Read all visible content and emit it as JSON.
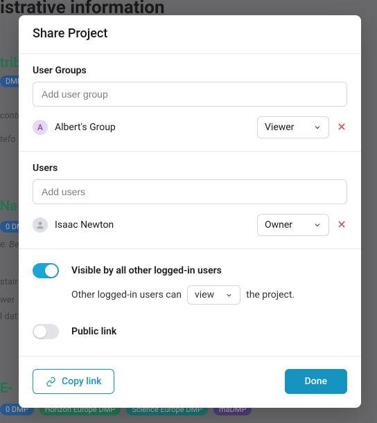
{
  "background": {
    "title_fragment": "istrative information",
    "chip1": "0 DMP",
    "chip2": "Horizon Europe DMP",
    "chip3": "Science Europe DMP",
    "chip4": "maDMP",
    "green_head": "E-"
  },
  "modal": {
    "title": "Share Project",
    "groups": {
      "label": "User Groups",
      "placeholder": "Add user group",
      "rows": [
        {
          "initial": "A",
          "name": "Albert's Group",
          "role": "Viewer"
        }
      ]
    },
    "users": {
      "label": "Users",
      "placeholder": "Add users",
      "rows": [
        {
          "name": "Isaac Newton",
          "role": "Owner"
        }
      ]
    },
    "visibility": {
      "visible_all_label": "Visible by all other logged-in users",
      "sub_prefix": "Other logged-in users can",
      "sub_select": "view",
      "sub_suffix": "the project.",
      "public_link_label": "Public link"
    },
    "footer": {
      "copy": "Copy link",
      "done": "Done"
    }
  }
}
